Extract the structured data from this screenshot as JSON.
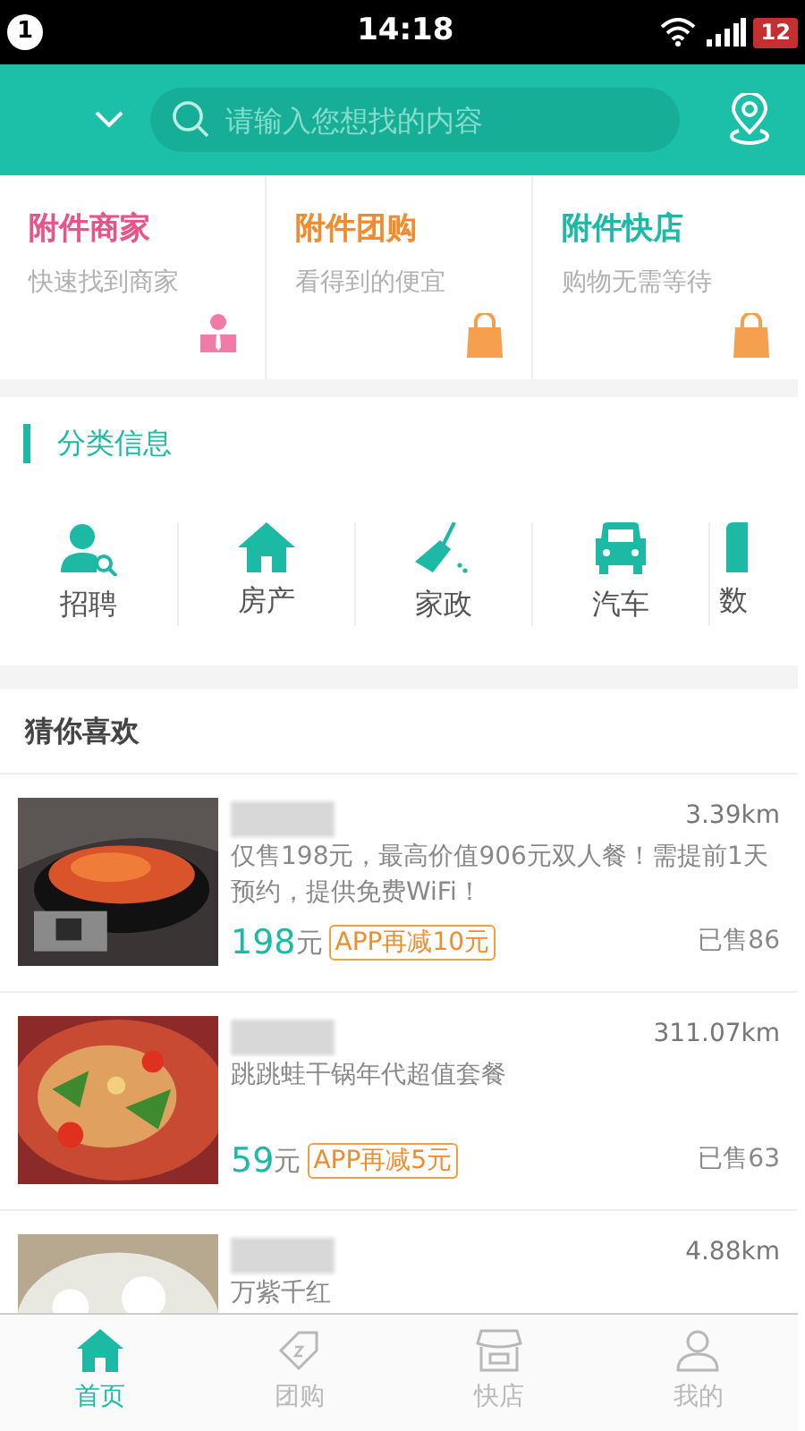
{
  "status_bar": {
    "notification": "1",
    "time": "14:18",
    "battery": "12"
  },
  "search": {
    "placeholder": "请输入您想找的内容"
  },
  "shortcuts": [
    {
      "title": "附件商家",
      "subtitle": "快速找到商家",
      "color": "#e8538a"
    },
    {
      "title": "附件团购",
      "subtitle": "看得到的便宜",
      "color": "#f08c2e"
    },
    {
      "title": "附件快店",
      "subtitle": "购物无需等待",
      "color": "#1cb9a4"
    }
  ],
  "categories": {
    "title": "分类信息",
    "items": [
      {
        "label": "招聘"
      },
      {
        "label": "房产"
      },
      {
        "label": "家政"
      },
      {
        "label": "汽车"
      },
      {
        "label": "数"
      }
    ]
  },
  "recommend": {
    "title": "猜你喜欢",
    "items": [
      {
        "distance": "3.39km",
        "description": "仅售198元，最高价值906元双人餐！需提前1天预约，提供免费WiFi！",
        "price": "198",
        "unit": "元",
        "promo": "APP再减10元",
        "sold": "已售86"
      },
      {
        "distance": "311.07km",
        "description": "跳跳蛙干锅年代超值套餐",
        "price": "59",
        "unit": "元",
        "promo": "APP再减5元",
        "sold": "已售63"
      },
      {
        "distance": "4.88km",
        "description": "万紫千红"
      }
    ]
  },
  "tab_bar": [
    {
      "label": "首页",
      "selected": true
    },
    {
      "label": "团购",
      "selected": false
    },
    {
      "label": "快店",
      "selected": false
    },
    {
      "label": "我的",
      "selected": false
    }
  ]
}
